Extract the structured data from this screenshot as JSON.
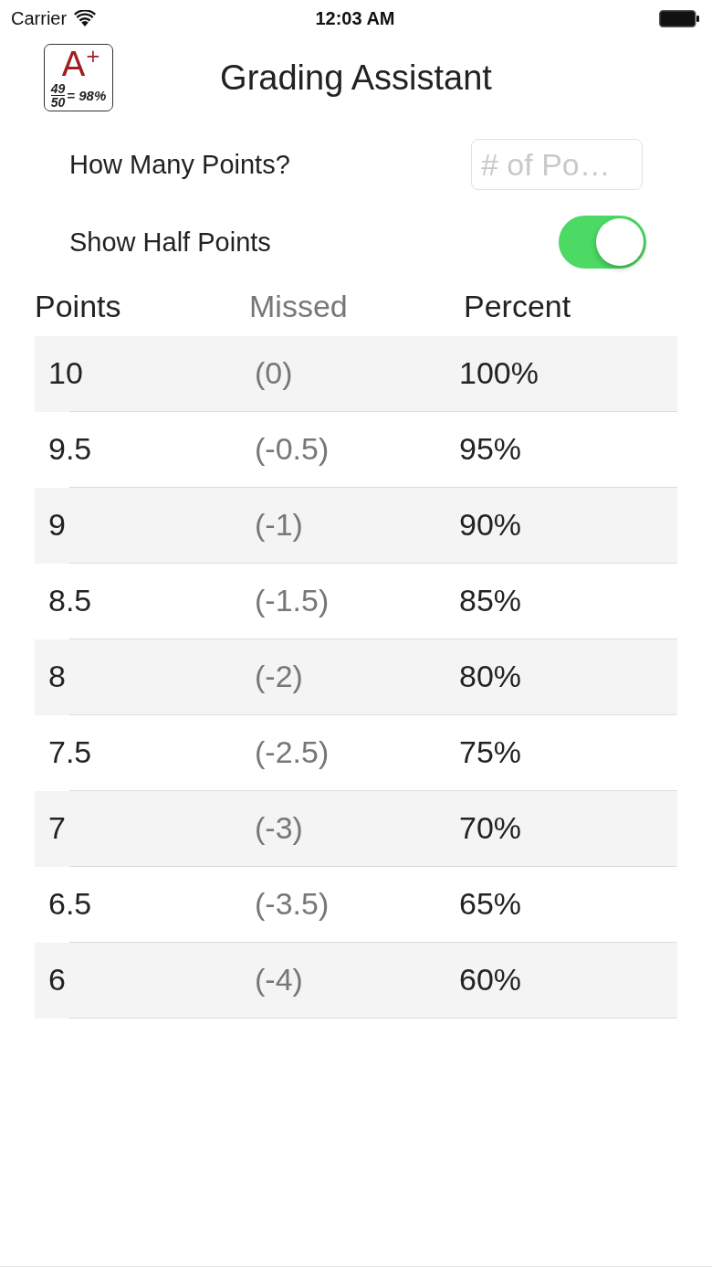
{
  "status_bar": {
    "carrier": "Carrier",
    "time": "12:03 AM"
  },
  "header": {
    "logo": {
      "grade": "A$^{+}$",
      "numerator": "49",
      "denominator": "50",
      "result": "= 98%"
    },
    "title": "Grading Assistant"
  },
  "points_field": {
    "label": "How Many Points?",
    "placeholder": "# of Po…"
  },
  "half_points": {
    "label": "Show Half Points",
    "on": true
  },
  "table": {
    "columns": [
      {
        "label": "Points",
        "kind": "primary"
      },
      {
        "label": "Missed",
        "kind": "muted"
      },
      {
        "label": "Percent",
        "kind": "primary"
      }
    ],
    "rows": [
      {
        "cells": [
          "10",
          "(0)",
          "100%"
        ]
      },
      {
        "cells": [
          "9.5",
          "(-0.5)",
          "95%"
        ]
      },
      {
        "cells": [
          "9",
          "(-1)",
          "90%"
        ]
      },
      {
        "cells": [
          "8.5",
          "(-1.5)",
          "85%"
        ]
      },
      {
        "cells": [
          "8",
          "(-2)",
          "80%"
        ]
      },
      {
        "cells": [
          "7.5",
          "(-2.5)",
          "75%"
        ]
      },
      {
        "cells": [
          "7",
          "(-3)",
          "70%"
        ]
      },
      {
        "cells": [
          "6.5",
          "(-3.5)",
          "65%"
        ]
      },
      {
        "cells": [
          "6",
          "(-4)",
          "60%"
        ]
      }
    ]
  }
}
